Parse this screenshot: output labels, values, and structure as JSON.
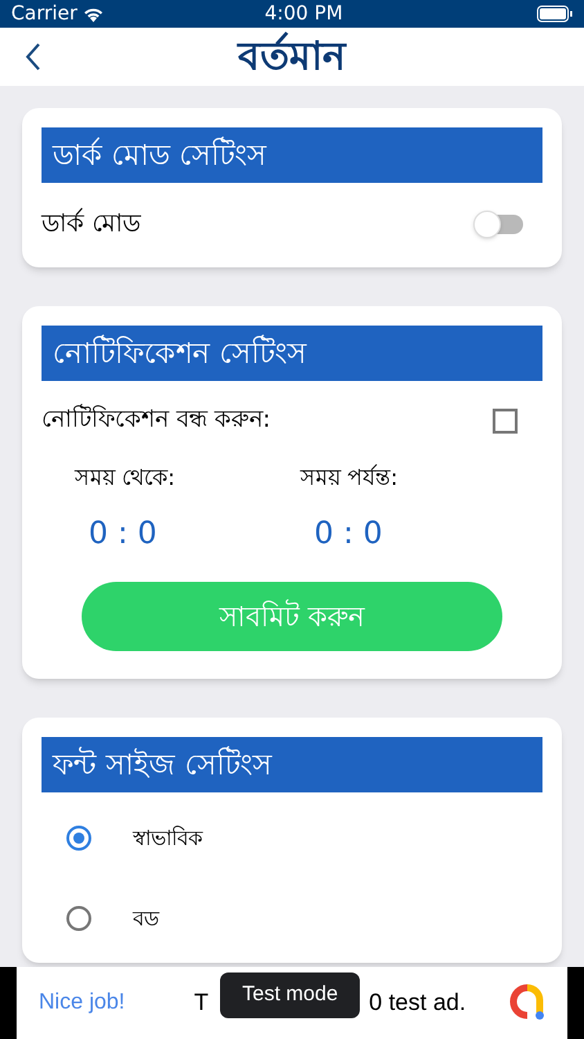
{
  "status_bar": {
    "carrier": "Carrier",
    "time": "4:00 PM"
  },
  "nav": {
    "logo": "বর্তমান"
  },
  "dark_mode": {
    "title": "ডার্ক মোড সেটিংস",
    "label": "ডার্ক মোড",
    "on": false
  },
  "notifications": {
    "title": "নোটিফিকেশন সেটিংস",
    "mute_label": "নোটিফিকেশন বন্ধ করুন:",
    "checked": false,
    "from_label": "সময় থেকে:",
    "from_value": "0 : 0",
    "to_label": "সময় পর্যন্ত:",
    "to_value": "0 : 0",
    "submit": "সাবমিট করুন"
  },
  "font_size": {
    "title": "ফন্ট সাইজ সেটিংস",
    "options": [
      {
        "label": "স্বাভাবিক",
        "selected": true
      },
      {
        "label": "বড",
        "selected": false
      }
    ]
  },
  "ad": {
    "headline": "Nice job!",
    "text_start": "T",
    "text_end": "0 test ad.",
    "badge": "Test mode"
  }
}
